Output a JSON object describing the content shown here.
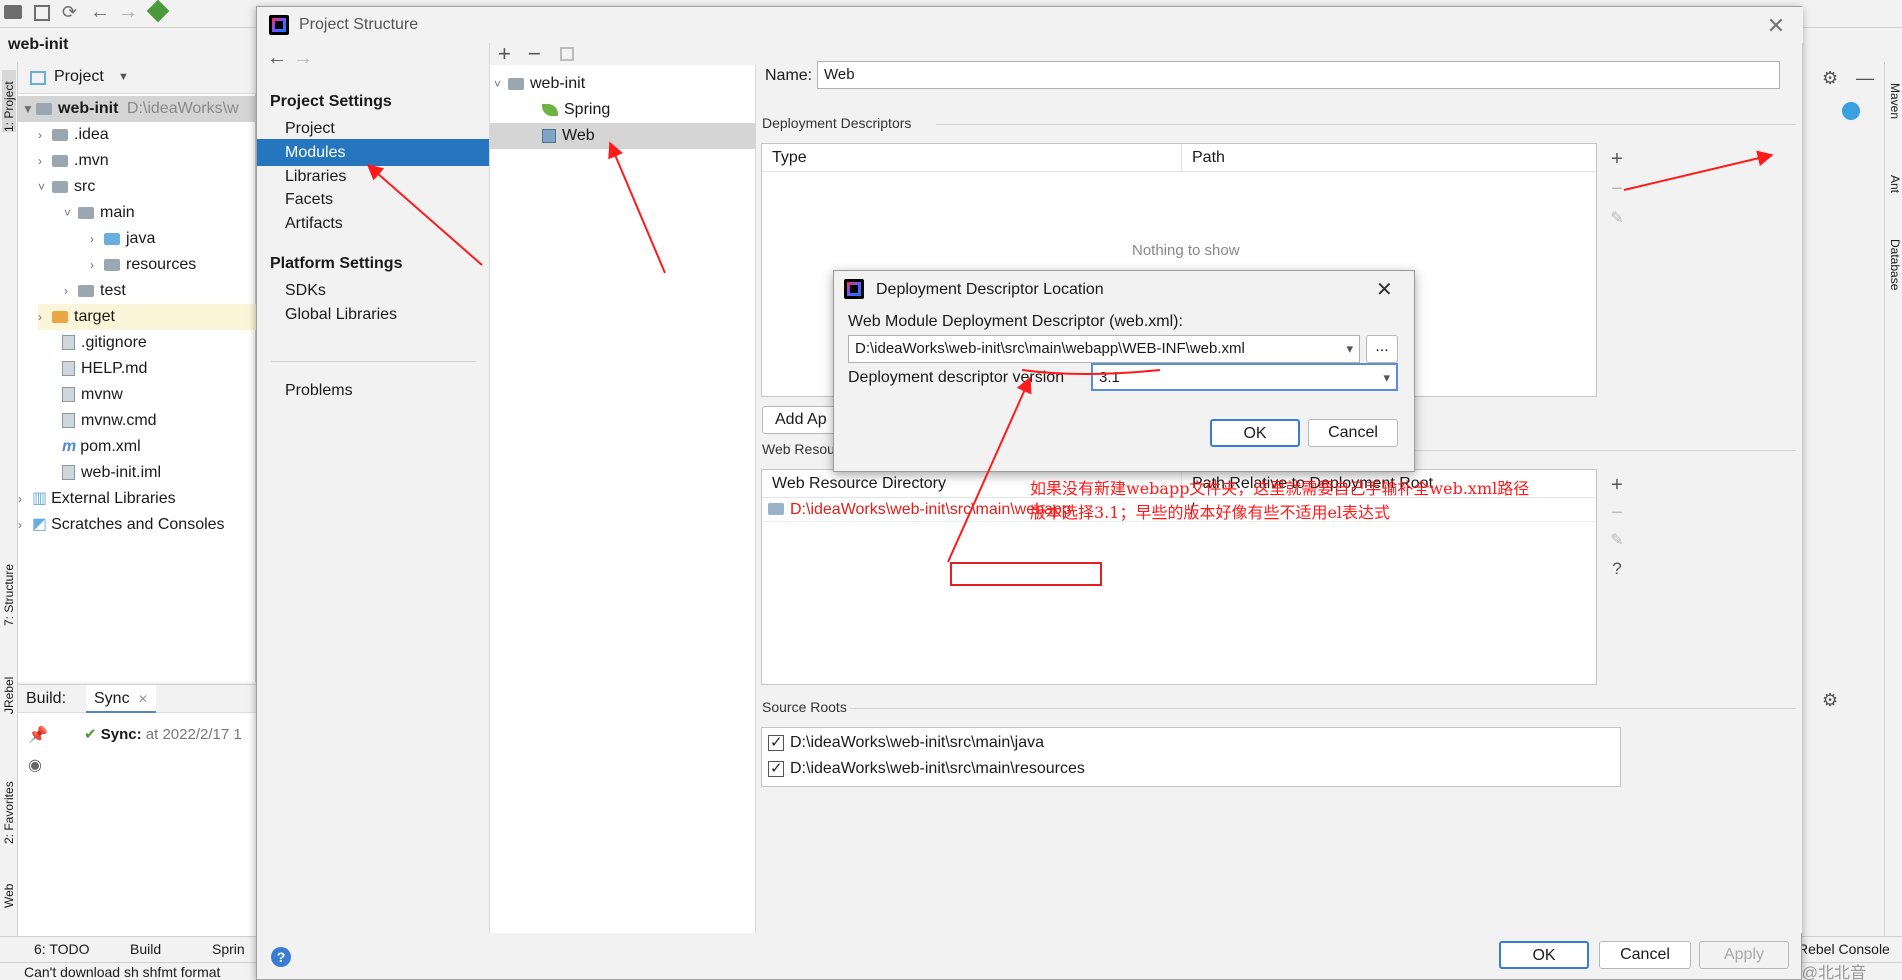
{
  "ide": {
    "breadcrumb": "web-init",
    "project_dropdown": "Project",
    "tree": [
      {
        "label": "web-init",
        "suffix": "D:\\ideaWorks\\w",
        "type": "module"
      },
      {
        "label": ".idea",
        "type": "folder"
      },
      {
        "label": ".mvn",
        "type": "folder"
      },
      {
        "label": "src",
        "type": "folder"
      },
      {
        "label": "main",
        "type": "folder"
      },
      {
        "label": "java",
        "type": "folder-blue"
      },
      {
        "label": "resources",
        "type": "folder"
      },
      {
        "label": "test",
        "type": "folder"
      },
      {
        "label": "target",
        "type": "folder-orange"
      },
      {
        "label": ".gitignore",
        "type": "file"
      },
      {
        "label": "HELP.md",
        "type": "file"
      },
      {
        "label": "mvnw",
        "type": "file"
      },
      {
        "label": "mvnw.cmd",
        "type": "file"
      },
      {
        "label": "pom.xml",
        "type": "file"
      },
      {
        "label": "web-init.iml",
        "type": "file"
      },
      {
        "label": "External Libraries",
        "type": "lib"
      },
      {
        "label": "Scratches and Consoles",
        "type": "lib"
      }
    ],
    "left_stripe": [
      "1: Project",
      "7: Structure",
      "JRebel",
      "2: Favorites",
      "Web"
    ],
    "right_stripe": [
      "Maven",
      "Ant",
      "Database"
    ],
    "build": {
      "label": "Build:",
      "tab": "Sync",
      "sync_text": "Sync:",
      "sync_time": "at 2022/2/17 1"
    },
    "bottom_tabs": [
      "6: TODO",
      "Build",
      "Sprin"
    ],
    "bottom_right": "Rebel Console",
    "status": "Can't download sh shfmt format",
    "watermark": "CSDN @北北音"
  },
  "dialog": {
    "title": "Project Structure",
    "project_settings_header": "Project Settings",
    "platform_settings_header": "Platform Settings",
    "nav_project": [
      "Project",
      "Modules",
      "Libraries",
      "Facets",
      "Artifacts"
    ],
    "nav_platform": [
      "SDKs",
      "Global Libraries"
    ],
    "nav_problems": "Problems",
    "modules": [
      {
        "label": "web-init"
      },
      {
        "label": "Spring"
      },
      {
        "label": "Web"
      }
    ],
    "name_label": "Name:",
    "name_value": "Web",
    "deployment_descriptors_label": "Deployment Descriptors",
    "dd_columns": [
      "Type",
      "Path"
    ],
    "dd_empty": "Nothing to show",
    "add_button": "Add Ap",
    "web_resource_label": "Web Resource Directories",
    "wr_columns": [
      "Web Resource Directory",
      "Path Relative to Deployment Root"
    ],
    "wr_rows": [
      {
        "dir": "D:\\ideaWorks\\web-init\\src\\main\\webapp",
        "rel": "/"
      }
    ],
    "source_roots_label": "Source Roots",
    "source_roots": [
      "D:\\ideaWorks\\web-init\\src\\main\\java",
      "D:\\ideaWorks\\web-init\\src\\main\\resources"
    ],
    "ok": "OK",
    "cancel": "Cancel",
    "apply": "Apply",
    "help": "?"
  },
  "subdialog": {
    "title": "Deployment Descriptor Location",
    "descriptor_label": "Web Module Deployment Descriptor (web.xml):",
    "descriptor_path": "D:\\ideaWorks\\web-init\\src\\main\\webapp\\WEB-INF\\web.xml",
    "browse": "...",
    "version_label": "Deployment descriptor version",
    "version_value": "3.1",
    "ok": "OK",
    "cancel": "Cancel"
  },
  "annotation": {
    "line1": "如果没有新建webapp文件夹，这里就需要自己手输补全web.xml路径",
    "line2": "版本选择3.1；早些的版本好像有些不适用el表达式"
  },
  "colors": {
    "accent": "#2675bf",
    "annotation": "#ff1a1a",
    "path_red": "#e0201a"
  }
}
